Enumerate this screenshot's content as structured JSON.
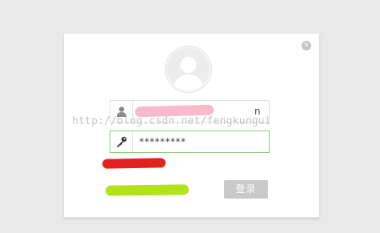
{
  "dialog": {
    "close_icon": "close-icon",
    "avatar_icon": "user-avatar-icon",
    "username_field": {
      "icon": "user-icon",
      "value": "n"
    },
    "password_field": {
      "icon": "key-icon",
      "value": "*********"
    },
    "login_button_label": "登录"
  },
  "watermark": "http://blog.csdn.net/fengkungui",
  "colors": {
    "background": "#e9e9e9",
    "dialog": "#ffffff",
    "password_border_active": "#8fc97f",
    "login_button": "#c9c9c9",
    "redaction_pink": "#f7b3c7",
    "redaction_red": "#e3221f",
    "redaction_green": "#b3e21b"
  }
}
